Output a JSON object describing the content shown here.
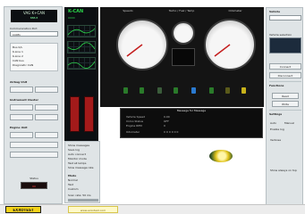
{
  "left": {
    "title": "VAG K+CAN",
    "digital_readout": "888.8",
    "connection_label": "Communication Port",
    "port_value": "COM1",
    "list_items": [
      "Bus K/L",
      "K-Line 1",
      "K-Line 2",
      "CAN bus",
      "Diagnostic CAN"
    ],
    "section1": "Airbag Unit",
    "section2": "Instrument Cluster",
    "section3": "Engine Unit",
    "footer_label": "Status",
    "footer_value": "00"
  },
  "colors": {
    "logo_yellow": "#f4d21a",
    "led_green": "#2bd24a",
    "accent_red": "#a31a1a"
  },
  "top_display": {
    "big_text": "K-CAN",
    "sub_text": "0000"
  },
  "dash": {
    "tab_labels": [
      "Speedo",
      "Tacho / Fuel / Temp",
      "Odometer"
    ],
    "message_title": "Message for Message",
    "message_rows": [
      {
        "k": "Vehicle Speed",
        "v": "0.00"
      },
      {
        "k": "Immo Status",
        "v": "OFF"
      },
      {
        "k": "Engine RPM",
        "v": "0"
      },
      {
        "k": "Odometer",
        "v": "000000"
      }
    ]
  },
  "options": {
    "checkboxes": [
      "Show messages",
      "Save log",
      "Auto connect",
      "Monitor mode",
      "Test all lamps",
      "Slow message rate"
    ],
    "mode_label": "Mode",
    "mode_items": [
      "Normal",
      "Test",
      "Custom"
    ],
    "slider_label": "Scan rate: 50 ms"
  },
  "right": {
    "header": "Vehicle",
    "input_label": "Vehicle selection",
    "btn1": "Connect",
    "btn2": "Disconnect",
    "section": "Functions",
    "sub1": "Read",
    "sub2": "Write",
    "section2": "Settings",
    "radio_items": [
      "Auto",
      "Manual"
    ],
    "check1": "Enable log",
    "check2": "Verbose",
    "bottom_check": "Show always on top"
  },
  "bottom": {
    "logo": "EXXOTEST",
    "website": "www.exxotest.com"
  }
}
